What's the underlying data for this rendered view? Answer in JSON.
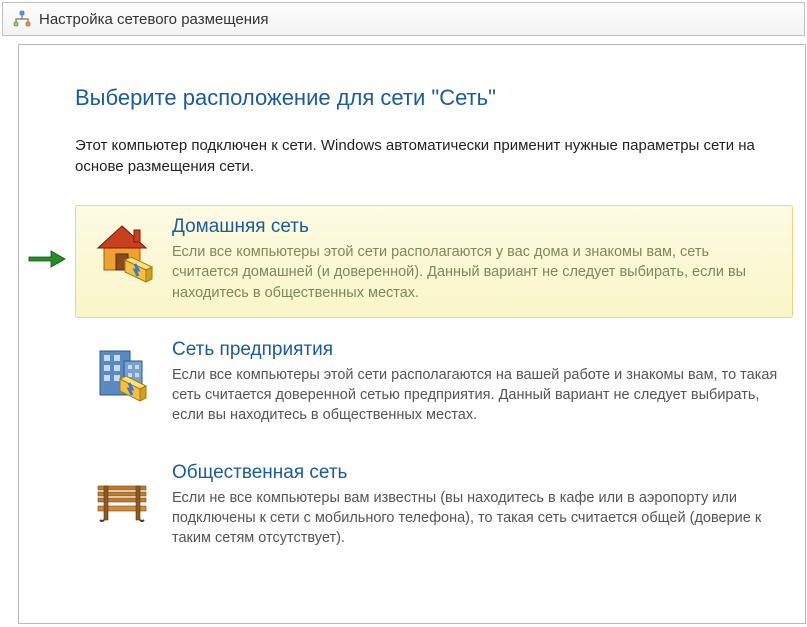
{
  "window": {
    "title": "Настройка сетевого размещения"
  },
  "content": {
    "heading": "Выберите расположение для сети \"Сеть\"",
    "intro": "Этот компьютер подключен к сети. Windows автоматически применит нужные параметры сети на основе размещения сети."
  },
  "options": {
    "home": {
      "icon": "house-icon",
      "title": "Домашняя сеть",
      "desc": "Если все компьютеры этой сети располагаются у вас дома и знакомы вам, сеть считается домашней (и доверенной). Данный вариант не следует выбирать, если вы находитесь в общественных местах.",
      "selected": true
    },
    "work": {
      "icon": "office-icon",
      "title": "Сеть предприятия",
      "desc": "Если все компьютеры этой сети располагаются на вашей работе и знакомы вам, то такая сеть считается доверенной сетью предприятия. Данный вариант не следует выбирать, если вы находитесь в общественных местах."
    },
    "public": {
      "icon": "bench-icon",
      "title": "Общественная сеть",
      "desc": "Если не все компьютеры вам известны (вы находитесь в кафе или в аэропорту или подключены к сети с мобильного телефона), то такая сеть считается общей (доверие к таким сетям отсутствует)."
    }
  }
}
